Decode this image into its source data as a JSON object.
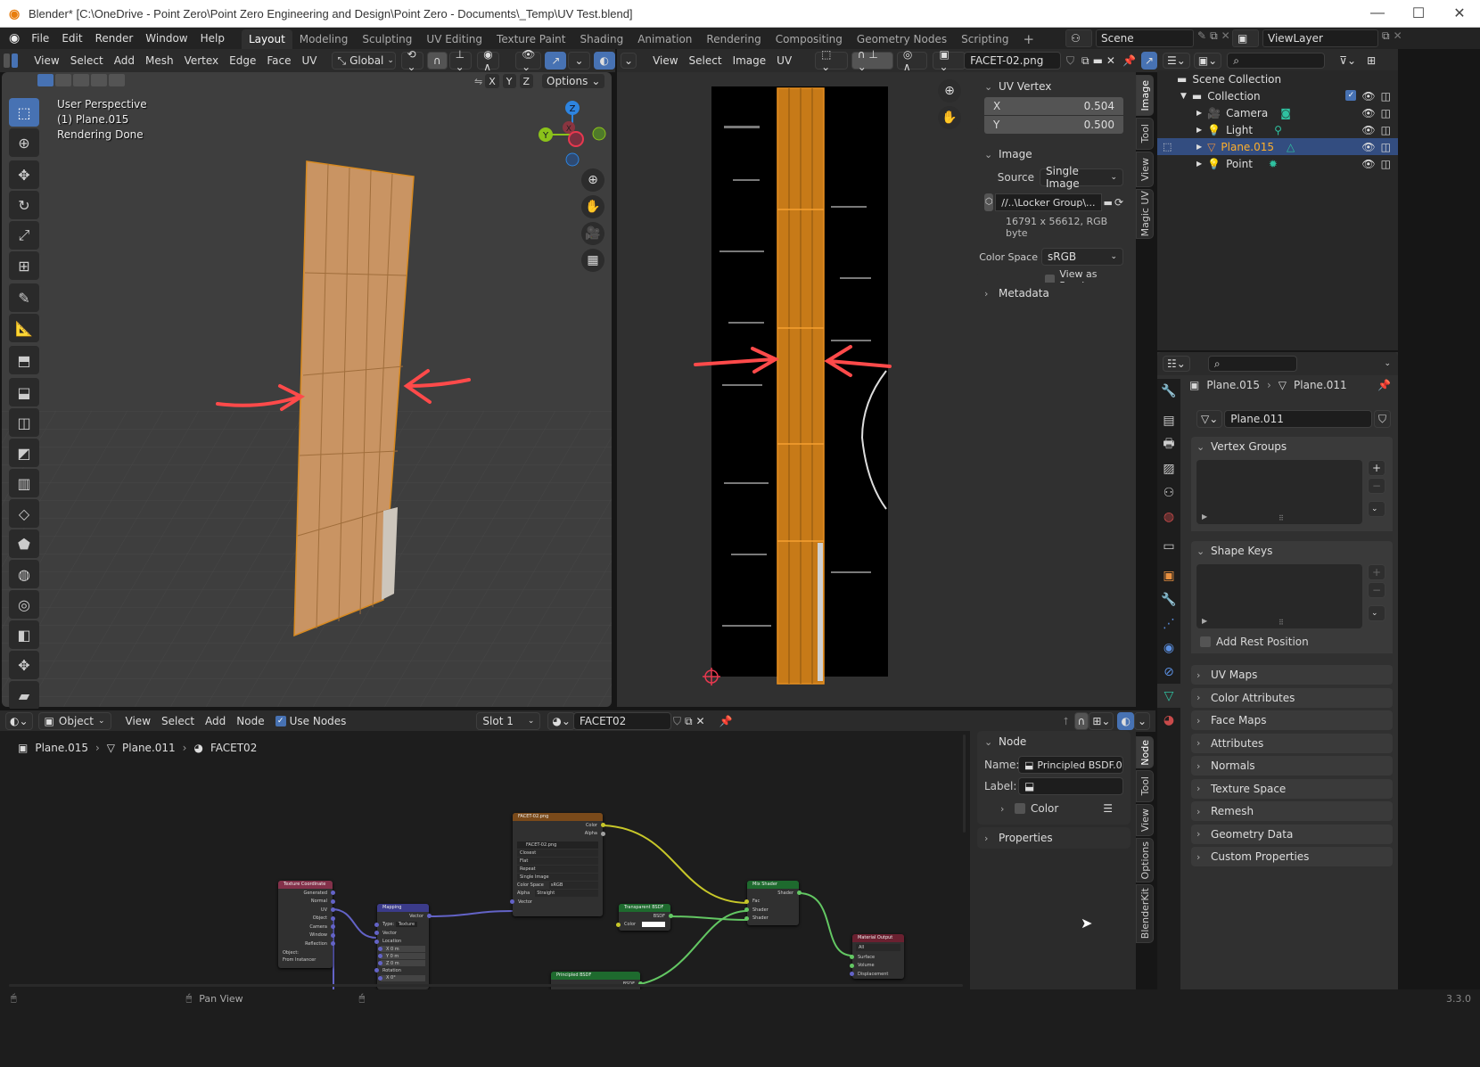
{
  "window": {
    "title": "Blender* [C:\\OneDrive - Point Zero\\Point Zero Engineering and Design\\Point Zero - Documents\\_Temp\\UV Test.blend]",
    "controls": {
      "minimize": "—",
      "maximize": "☐",
      "close": "✕"
    }
  },
  "topbar": {
    "menus": [
      "File",
      "Edit",
      "Render",
      "Window",
      "Help"
    ],
    "workspaces": [
      {
        "label": "Layout",
        "active": true
      },
      {
        "label": "Modeling",
        "active": false
      },
      {
        "label": "Sculpting",
        "active": false
      },
      {
        "label": "UV Editing",
        "active": false
      },
      {
        "label": "Texture Paint",
        "active": false
      },
      {
        "label": "Shading",
        "active": false
      },
      {
        "label": "Animation",
        "active": false
      },
      {
        "label": "Rendering",
        "active": false
      },
      {
        "label": "Compositing",
        "active": false
      },
      {
        "label": "Geometry Nodes",
        "active": false
      },
      {
        "label": "Scripting",
        "active": false
      }
    ],
    "add_workspace": "+",
    "scene": "Scene",
    "view_layer": "ViewLayer"
  },
  "viewport3d": {
    "header_menus": [
      "View",
      "Select",
      "Add",
      "Mesh",
      "Vertex",
      "Edge",
      "Face",
      "UV"
    ],
    "transform_orientation": "Global",
    "axis_toggles": [
      "X",
      "Y",
      "Z"
    ],
    "options_label": "Options",
    "overlay_lines": [
      "User Perspective",
      "(1) Plane.015",
      "Rendering Done"
    ],
    "gizmo_axes": {
      "z": "Z",
      "y": "Y",
      "x": "X"
    },
    "colors": {
      "x_axis": "#e8384f",
      "y_axis": "#8bc21a",
      "z_axis": "#2d84e0",
      "mesh_face": "#c99463",
      "annotation": "#ff4a4a"
    }
  },
  "uv_editor": {
    "header_menus": [
      "View",
      "Select",
      "Image",
      "UV"
    ],
    "image_name": "FACET-02.png",
    "sidebar_tabs": [
      "Image",
      "Tool",
      "View",
      "Magic UV"
    ],
    "uv_vertex": {
      "title": "UV Vertex",
      "x_label": "X",
      "x_value": "0.504",
      "y_label": "Y",
      "y_value": "0.500"
    },
    "image_panel": {
      "title": "Image",
      "source_label": "Source",
      "source_value": "Single Image",
      "filepath": "//..\\Locker Group\\...",
      "info": "16791 x 56612,  RGB byte",
      "color_space_label": "Color Space",
      "color_space_value": "sRGB",
      "view_as_render": "View as Rend..."
    },
    "metadata_title": "Metadata"
  },
  "outliner": {
    "root": "Scene Collection",
    "collection": "Collection",
    "items": [
      {
        "name": "Camera",
        "selected": false
      },
      {
        "name": "Light",
        "selected": false
      },
      {
        "name": "Plane.015",
        "selected": true
      },
      {
        "name": "Point",
        "selected": false
      }
    ]
  },
  "properties": {
    "breadcrumb_object": "Plane.015",
    "breadcrumb_data": "Plane.011",
    "mesh_name": "Plane.011",
    "vertex_groups": "Vertex Groups",
    "shape_keys": "Shape Keys",
    "add_rest_position": "Add Rest Position",
    "sections": [
      "UV Maps",
      "Color Attributes",
      "Face Maps",
      "Attributes",
      "Normals",
      "Texture Space",
      "Remesh",
      "Geometry Data",
      "Custom Properties"
    ]
  },
  "node_editor": {
    "mode": "Object",
    "header_menus": [
      "View",
      "Select",
      "Add",
      "Node"
    ],
    "use_nodes_label": "Use Nodes",
    "use_nodes_checked": true,
    "slot": "Slot 1",
    "material": "FACET02",
    "breadcrumb": [
      "Plane.015",
      "Plane.011",
      "FACET02"
    ],
    "sidebar_tabs": [
      "Node",
      "Tool",
      "View",
      "Options",
      "BlenderKit"
    ],
    "node_panel": {
      "title": "Node",
      "name_label": "Name:",
      "name_value": "Principled BSDF.0...",
      "label_label": "Label:",
      "label_value": "",
      "color_label": "Color",
      "properties_title": "Properties"
    },
    "nodes": {
      "texcoord": {
        "title": "Texture Coordinate",
        "outputs": [
          "Generated",
          "Normal",
          "UV",
          "Object",
          "Camera",
          "Window",
          "Reflection"
        ],
        "object_label": "Object:",
        "from_instancer": "From Instancer"
      },
      "mapping": {
        "title": "Mapping",
        "output": "Vector",
        "type_label": "Type:",
        "type_value": "Texture",
        "inputs": [
          "Vector",
          "Location"
        ],
        "loc_values": [
          "X  0 m",
          "Y  0 m",
          "Z  0 m"
        ],
        "rotation": "Rotation",
        "rot_x": "X  0°"
      },
      "image": {
        "title": "FACET-02.png",
        "outputs": [
          "Color",
          "Alpha"
        ],
        "image": "FACET-02.png",
        "interp": "Closest",
        "proj": "Flat",
        "ext": "Repeat",
        "source": "Single Image",
        "cs_label": "Color Space",
        "cs_value": "sRGB",
        "alpha_label": "Alpha",
        "alpha_value": "Straight",
        "input": "Vector"
      },
      "transparent": {
        "title": "Transparent BSDF",
        "output": "BSDF",
        "input": "Color"
      },
      "mixshader": {
        "title": "Mix Shader",
        "output": "Shader",
        "inputs": [
          "Fac",
          "Shader",
          "Shader"
        ]
      },
      "principled": {
        "title": "Principled BSDF",
        "output": "BSDF"
      },
      "output": {
        "title": "Material Output",
        "target": "All",
        "inputs": [
          "Surface",
          "Volume",
          "Displacement"
        ]
      }
    }
  },
  "statusbar": {
    "action": "Pan View",
    "version": "3.3.0"
  }
}
